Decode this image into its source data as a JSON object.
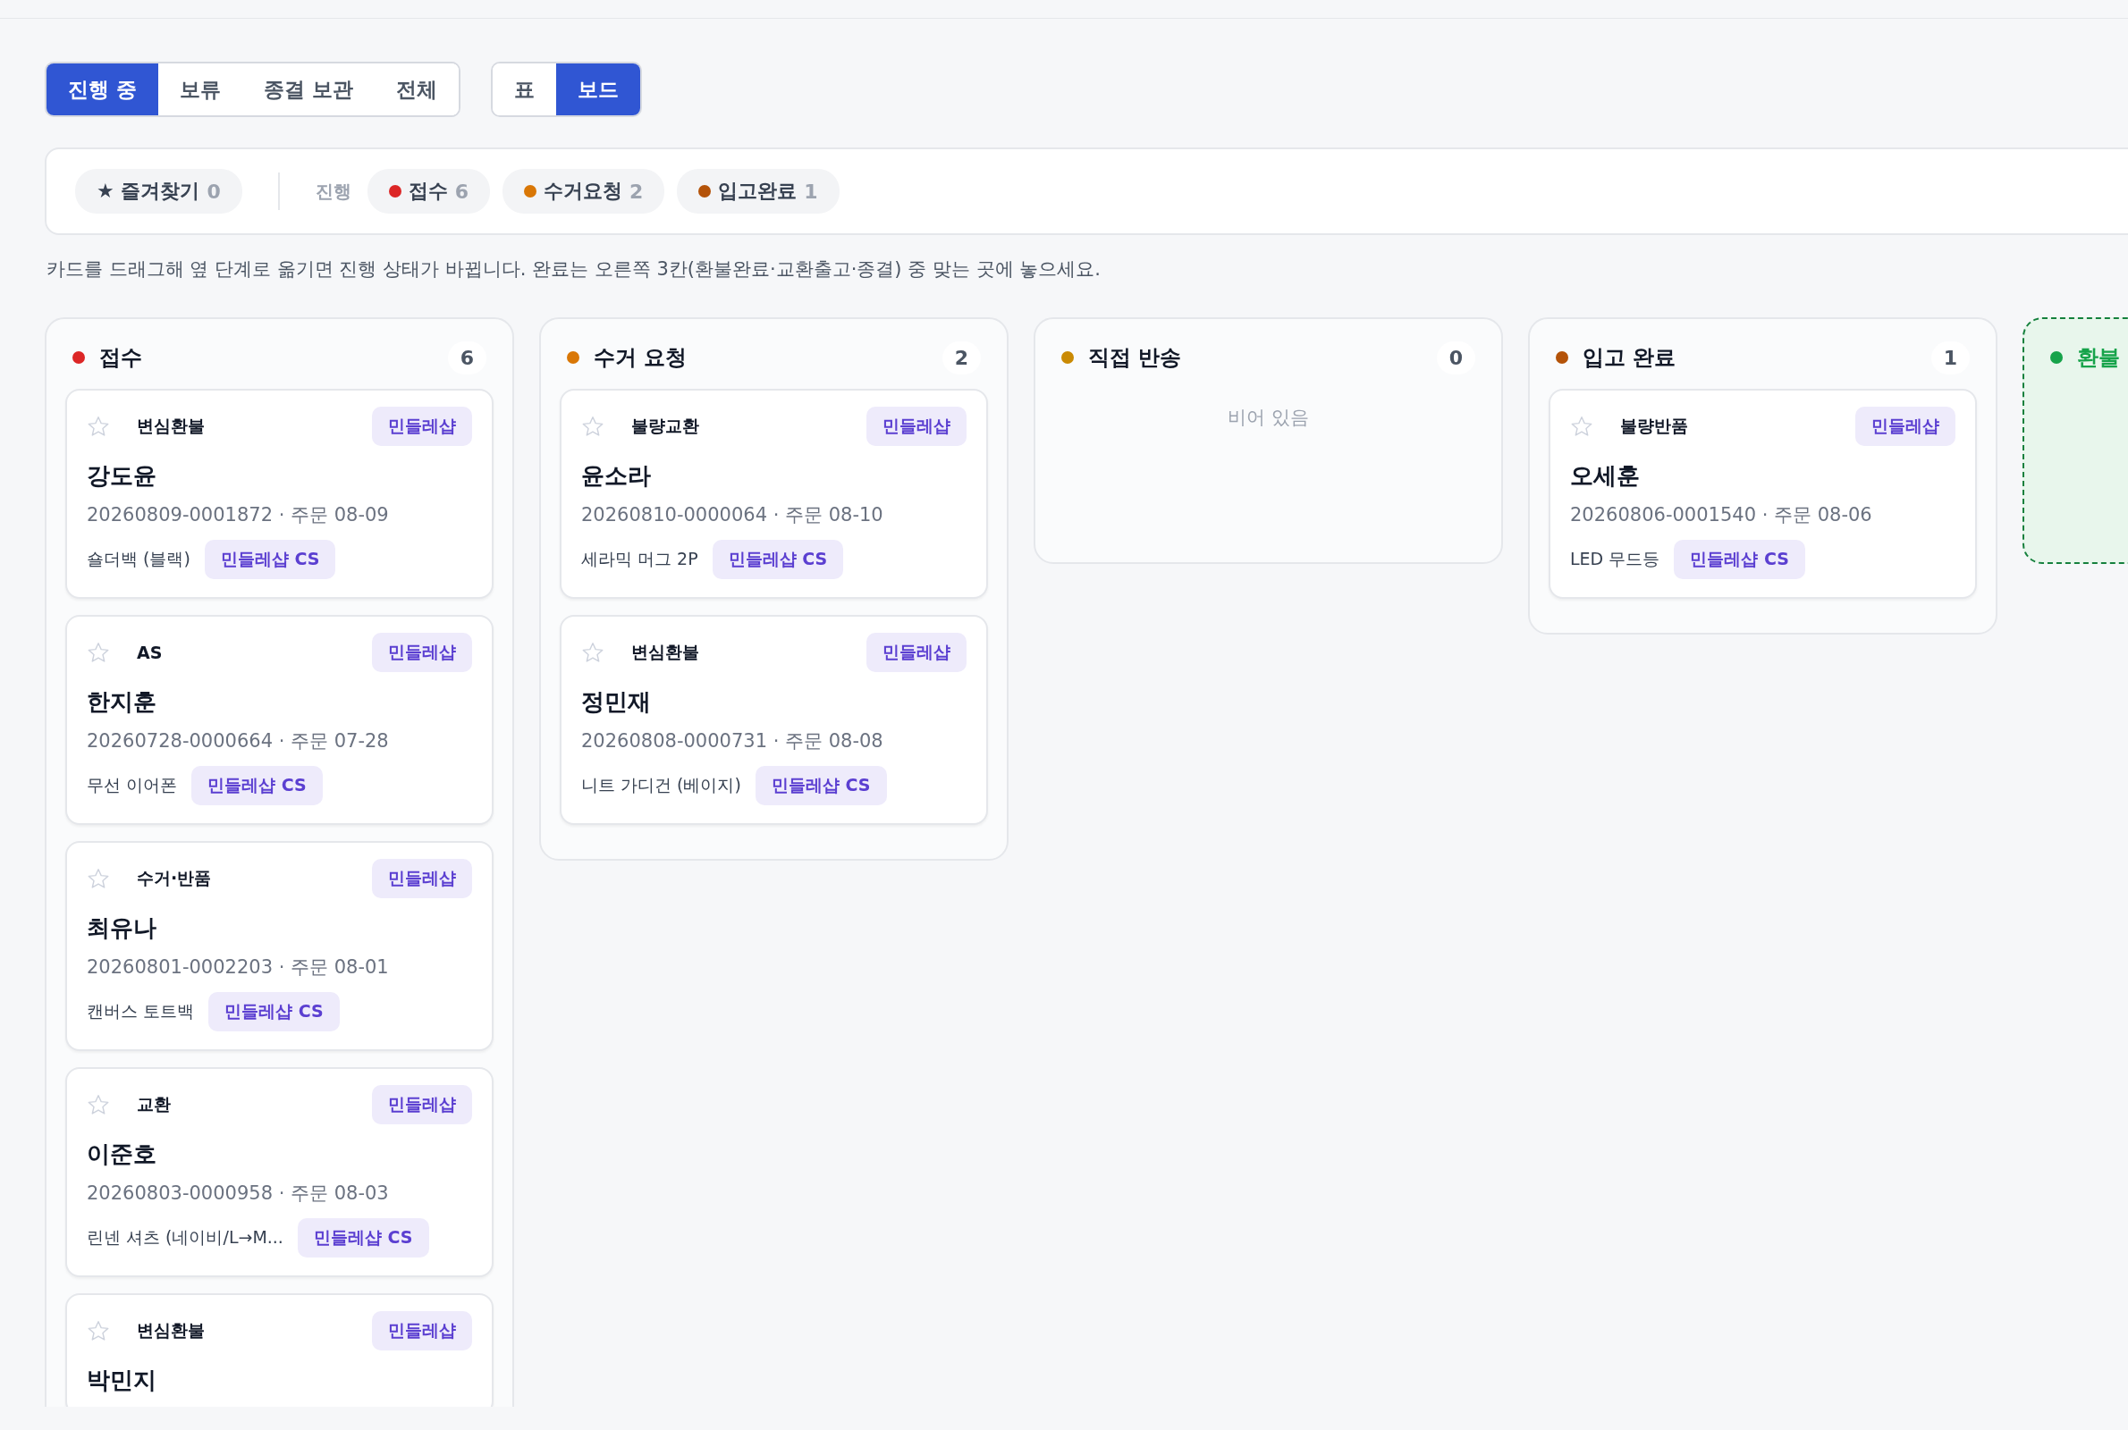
{
  "status_tabs": [
    {
      "label": "진행 중",
      "selected": true
    },
    {
      "label": "보류",
      "selected": false
    },
    {
      "label": "종결 보관",
      "selected": false
    },
    {
      "label": "전체",
      "selected": false
    }
  ],
  "view_tabs": [
    {
      "label": "표",
      "selected": false
    },
    {
      "label": "보드",
      "selected": true
    }
  ],
  "filters": {
    "favorites": {
      "icon": "★",
      "label": "즐겨찾기",
      "count": "0"
    },
    "group_label": "진행",
    "chips": [
      {
        "label": "접수",
        "count": "6",
        "color": "#dc2626"
      },
      {
        "label": "수거요청",
        "count": "2",
        "color": "#d97706"
      },
      {
        "label": "입고완료",
        "count": "1",
        "color": "#b45309"
      }
    ]
  },
  "hint": "카드를 드래그해 옆 단계로 옮기면 진행 상태가 바뀝니다. 완료는 오른쪽 3칸(환불완료·교환출고·종결) 중 맞는 곳에 놓으세요.",
  "columns": [
    {
      "kind": "stage",
      "title": "접수",
      "count": "6",
      "color": "#dc2626",
      "cards": [
        {
          "starred": false,
          "type": "변심환불",
          "shop": "민들레샵",
          "name": "강도윤",
          "order": "20260809-0001872 · 주문 08-09",
          "product": "숄더백 (블랙)",
          "team": "민들레샵 CS"
        },
        {
          "starred": false,
          "type": "AS",
          "shop": "민들레샵",
          "name": "한지훈",
          "order": "20260728-0000664 · 주문 07-28",
          "product": "무선 이어폰",
          "team": "민들레샵 CS"
        },
        {
          "starred": false,
          "type": "수거·반품",
          "shop": "민들레샵",
          "name": "최유나",
          "order": "20260801-0002203 · 주문 08-01",
          "product": "캔버스 토트백",
          "team": "민들레샵 CS"
        },
        {
          "starred": false,
          "type": "교환",
          "shop": "민들레샵",
          "name": "이준호",
          "order": "20260803-0000958 · 주문 08-03",
          "product": "린넨 셔츠 (네이비/L→M...",
          "team": "민들레샵 CS"
        },
        {
          "starred": false,
          "type": "변심환불",
          "shop": "민들레샵",
          "name": "박민지"
        }
      ]
    },
    {
      "kind": "stage",
      "title": "수거 요청",
      "count": "2",
      "color": "#d97706",
      "cards": [
        {
          "starred": false,
          "type": "불량교환",
          "shop": "민들레샵",
          "name": "윤소라",
          "order": "20260810-0000064 · 주문 08-10",
          "product": "세라믹 머그 2P",
          "team": "민들레샵 CS"
        },
        {
          "starred": false,
          "type": "변심환불",
          "shop": "민들레샵",
          "name": "정민재",
          "order": "20260808-0000731 · 주문 08-08",
          "product": "니트 가디건 (베이지)",
          "team": "민들레샵 CS"
        }
      ]
    },
    {
      "kind": "stage",
      "title": "직접 반송",
      "count": "0",
      "color": "#ca8a04",
      "empty_text": "비어 있음"
    },
    {
      "kind": "stage",
      "title": "입고 완료",
      "count": "1",
      "color": "#b45309",
      "cards": [
        {
          "starred": false,
          "type": "불량반품",
          "shop": "민들레샵",
          "name": "오세훈",
          "order": "20260806-0001540 · 주문 08-06",
          "product": "LED 무드등",
          "team": "민들레샵 CS"
        }
      ]
    },
    {
      "kind": "done",
      "title": "환불",
      "color": "#16a34a"
    }
  ]
}
